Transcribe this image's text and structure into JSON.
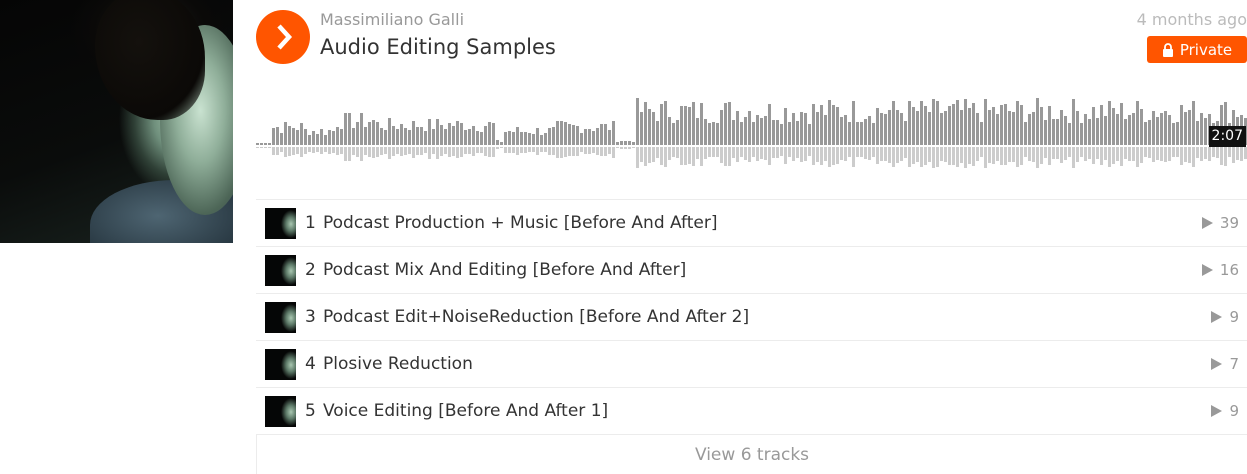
{
  "header": {
    "username": "Massimiliano Galli",
    "title": "Audio Editing Samples",
    "posted": "4 months ago",
    "privacy_label": "Private"
  },
  "player": {
    "duration": "2:07",
    "accent_color": "#ff5500"
  },
  "tracks": [
    {
      "num": "1",
      "title": "Podcast Production + Music [Before And After]",
      "plays": "39"
    },
    {
      "num": "2",
      "title": "Podcast Mix And Editing [Before And After]",
      "plays": "16"
    },
    {
      "num": "3",
      "title": "Podcast Edit+NoiseReduction [Before And After 2]",
      "plays": "9"
    },
    {
      "num": "4",
      "title": "Plosive Reduction",
      "plays": "7"
    },
    {
      "num": "5",
      "title": "Voice Editing [Before And After 1]",
      "plays": "9"
    }
  ],
  "view_all_label": "View 6 tracks",
  "icons": {
    "play": "play-icon",
    "lock": "lock-icon",
    "play_count": "play-count-icon"
  }
}
